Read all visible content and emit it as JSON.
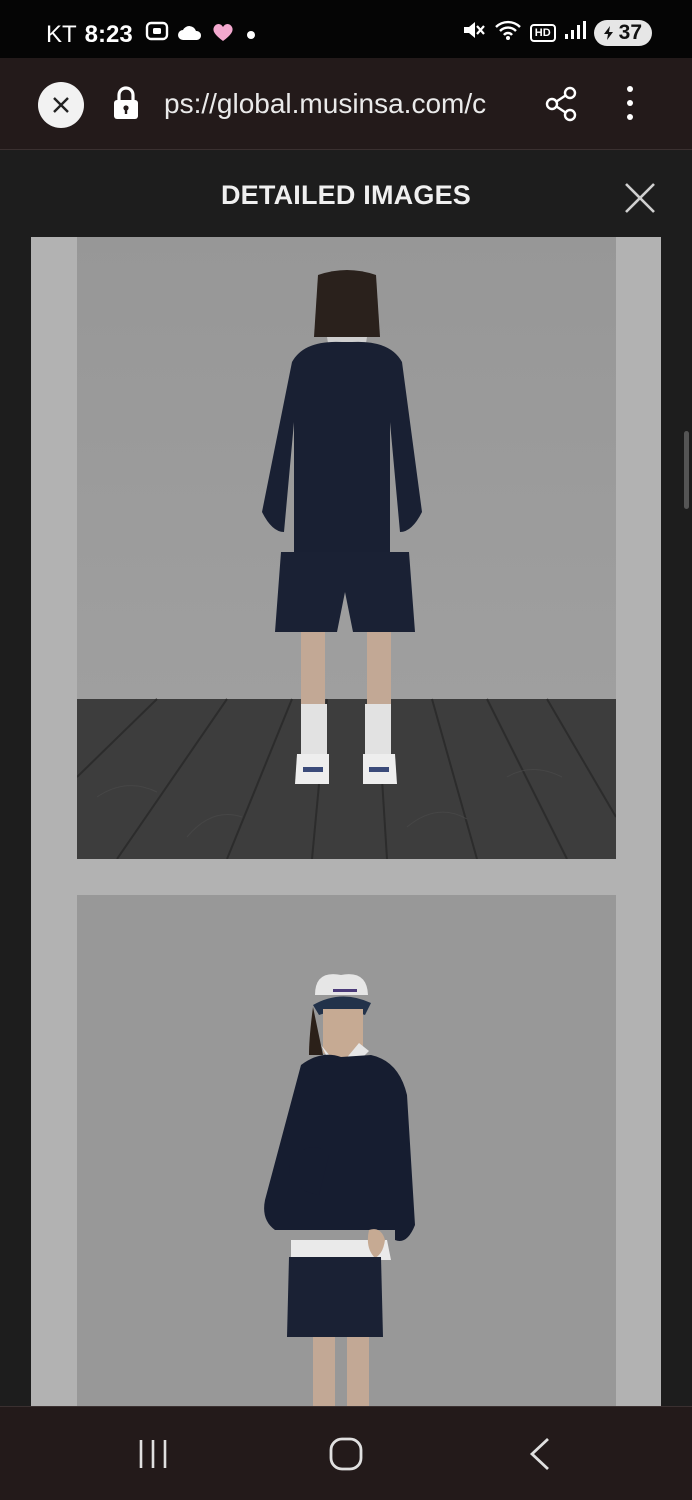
{
  "status_bar": {
    "carrier": "KT",
    "time": "8:23",
    "battery": "37",
    "hd_label": "HD",
    "icons": [
      "screen-record-icon",
      "cloud-icon",
      "heart-icon",
      "dot-icon",
      "mute-icon",
      "wifi-icon",
      "signal-icon",
      "battery-icon"
    ]
  },
  "browser": {
    "url": "ps://global.musinsa.com/c",
    "icons": [
      "close-icon",
      "lock-icon",
      "share-icon",
      "more-vert-icon"
    ]
  },
  "modal": {
    "title": "DETAILED IMAGES"
  },
  "nav": {
    "icons": [
      "recent-apps-icon",
      "home-icon",
      "back-icon"
    ]
  },
  "colors": {
    "status_bg": "#050505",
    "browser_bg": "#231a1a",
    "modal_bg": "#1d1d1d",
    "image_panel_bg": "#b2b2b2"
  }
}
